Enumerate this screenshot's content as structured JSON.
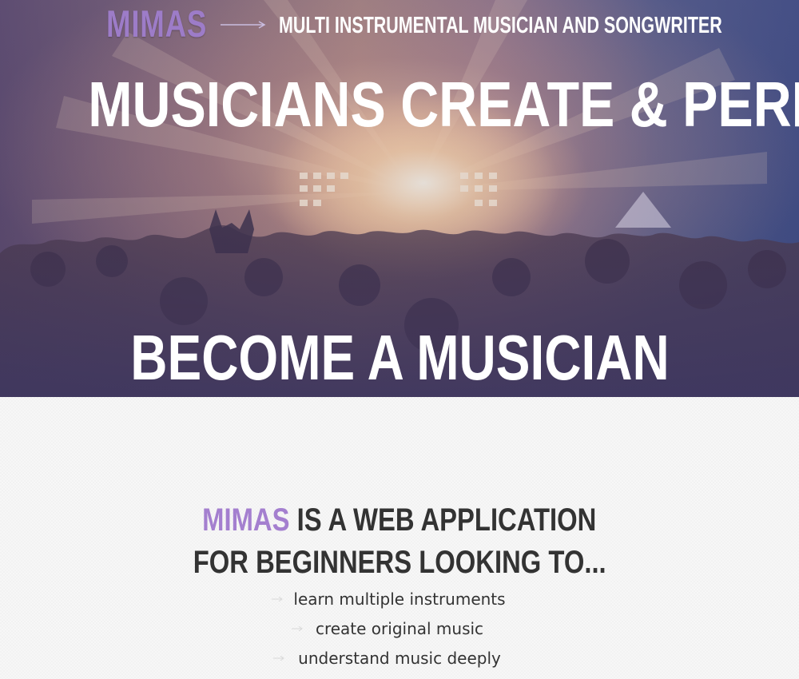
{
  "header": {
    "logo": "MIMAS",
    "tagline": "MULTI INSTRUMENTAL MUSICIAN AND SONGWRITER"
  },
  "hero": {
    "headline": "MUSICIANS CREATE & PERFORM",
    "cta": "BECOME A MUSICIAN"
  },
  "about": {
    "brand": "MIMAS",
    "line1_rest": " IS A WEB APPLICATION",
    "line2": "FOR BEGINNERS LOOKING TO...",
    "features": [
      "learn multiple instruments",
      "create original music",
      "understand music deeply"
    ]
  },
  "colors": {
    "brand_purple": "#a47fcf",
    "heading_dark": "#333333",
    "hero_text": "#ffffff"
  }
}
